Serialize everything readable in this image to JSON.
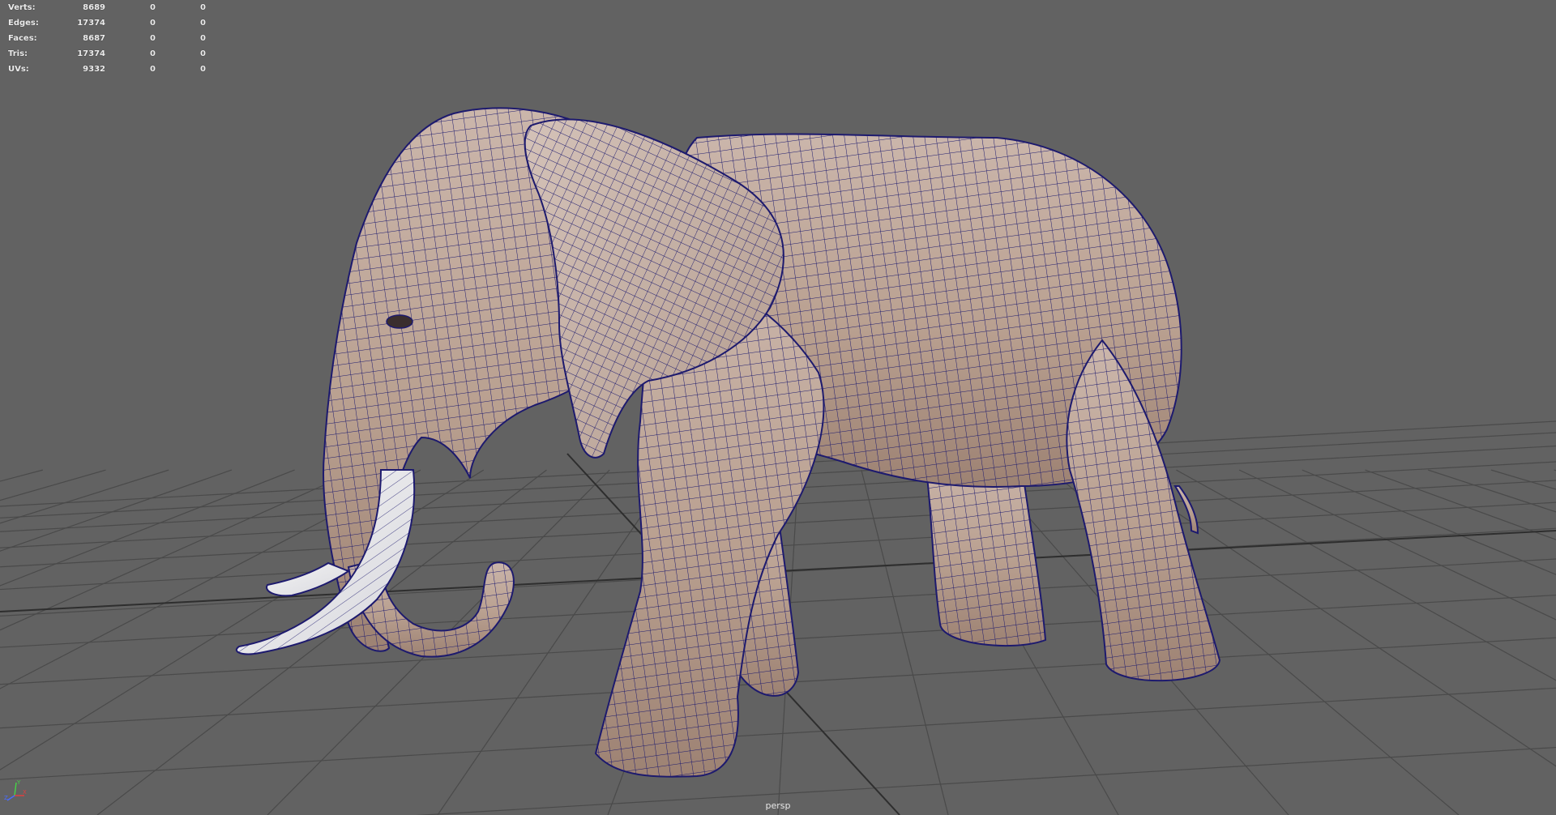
{
  "hud": {
    "rows": [
      {
        "label": "Verts:",
        "total": "8689",
        "selected": "0",
        "component": "0"
      },
      {
        "label": "Edges:",
        "total": "17374",
        "selected": "0",
        "component": "0"
      },
      {
        "label": "Faces:",
        "total": "8687",
        "selected": "0",
        "component": "0"
      },
      {
        "label": "Tris:",
        "total": "17374",
        "selected": "0",
        "component": "0"
      },
      {
        "label": "UVs:",
        "total": "9332",
        "selected": "0",
        "component": "0"
      }
    ]
  },
  "viewport": {
    "camera": "persp",
    "background_color": "#626262",
    "grid_color": "#4a4a4a",
    "wireframe_color": "#1d1a6e",
    "skin_color": "#bfa89a",
    "tusk_color": "#eeeeee"
  },
  "axis_indicator": {
    "labels": [
      "Y",
      "X",
      "Z"
    ],
    "colors": [
      "#47d147",
      "#e04040",
      "#4a6cff"
    ]
  }
}
